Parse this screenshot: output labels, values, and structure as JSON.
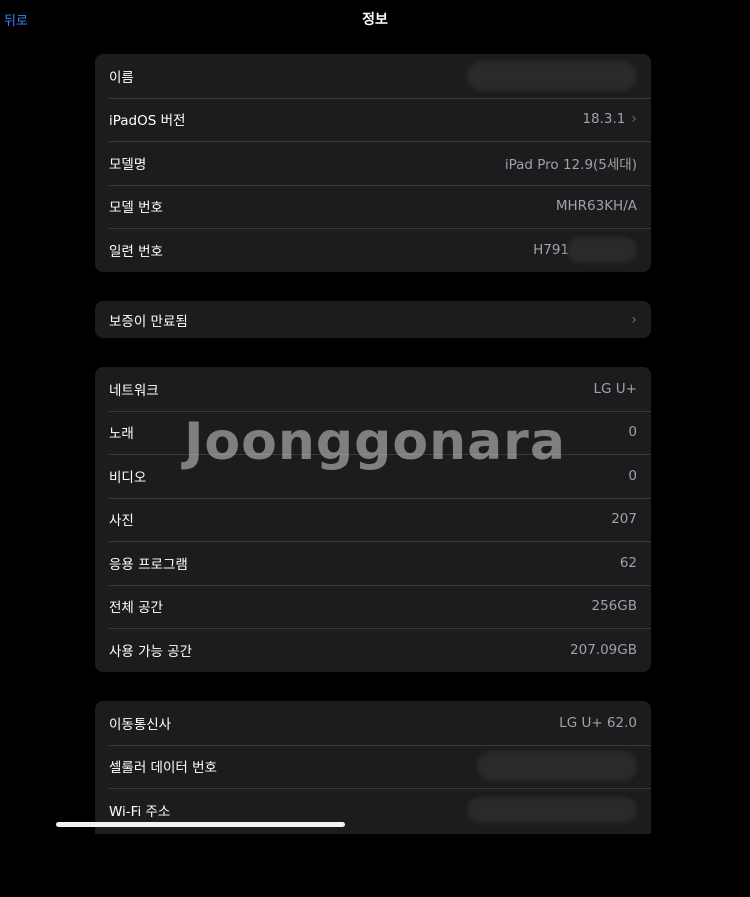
{
  "nav": {
    "back_label": "뒤로",
    "title": "정보"
  },
  "device_group": [
    {
      "label": "이름",
      "value": "",
      "redacted": true
    },
    {
      "label": "iPadOS 버전",
      "value": "18.3.1",
      "chevron": true
    },
    {
      "label": "모델명",
      "value": "iPad Pro 12.9(5세대)"
    },
    {
      "label": "모델 번호",
      "value": "MHR63KH/A"
    },
    {
      "label": "일련 번호",
      "value": "H791",
      "redacted": true
    }
  ],
  "warranty_group": [
    {
      "label": "보증이 만료됨",
      "chevron": true
    }
  ],
  "usage_group": [
    {
      "label": "네트워크",
      "value": "LG U+"
    },
    {
      "label": "노래",
      "value": "0"
    },
    {
      "label": "비디오",
      "value": "0"
    },
    {
      "label": "사진",
      "value": "207"
    },
    {
      "label": "응용 프로그램",
      "value": "62"
    },
    {
      "label": "전체 공간",
      "value": "256GB"
    },
    {
      "label": "사용 가능 공간",
      "value": "207.09GB"
    }
  ],
  "carrier_group": [
    {
      "label": "이동통신사",
      "value": "LG U+ 62.0"
    },
    {
      "label": "셀룰러 데이터 번호",
      "value": "",
      "redacted": true
    },
    {
      "label": "Wi-Fi 주소",
      "value": "",
      "redacted": true
    }
  ],
  "watermark": "Joonggonara",
  "colors": {
    "background": "#000000",
    "group_background": "#1c1c1e",
    "separator": "#38383a",
    "accent": "#3a82f7",
    "secondary_text": "#a1a1a6"
  }
}
